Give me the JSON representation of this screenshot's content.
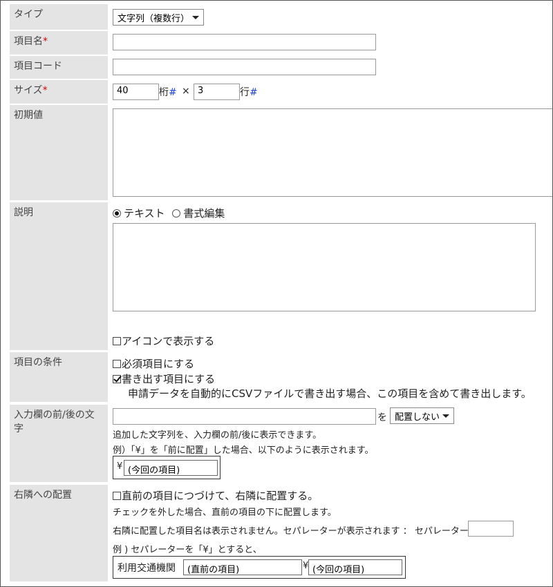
{
  "labels": {
    "type": "タイプ",
    "item_name": "項目名",
    "item_code": "項目コード",
    "size": "サイズ",
    "initial_value": "初期値",
    "description": "説明",
    "condition": "項目の条件",
    "prefix_suffix": "入力欄の前/後の文字",
    "align_right": "右隣への配置",
    "required_mark": "*"
  },
  "type_select": {
    "value": "文字列（複数行）"
  },
  "item_name_input": {
    "value": ""
  },
  "item_code_input": {
    "value": ""
  },
  "size": {
    "cols_value": "40",
    "cols_unit": "桁",
    "hash": "#",
    "times": "×",
    "rows_value": "3",
    "rows_unit": "行"
  },
  "description": {
    "radio_text": "テキスト",
    "radio_rich": "書式編集",
    "selected": "text",
    "show_icon_label": "アイコンで表示する",
    "show_icon_checked": false
  },
  "condition": {
    "required_label": "必須項目にする",
    "required_checked": false,
    "export_label": "書き出す項目にする",
    "export_checked": true,
    "export_note": "申請データを自動的にCSVファイルで書き出す場合、この項目を含めて書き出します。"
  },
  "prefix_suffix": {
    "text_value": "",
    "wo": "を",
    "placement_select": "配置しない",
    "help1": "追加した文字列を、入力欄の前/後に表示できます。",
    "help2": "例）「¥」を「前に配置」した場合、以下のように表示されます。",
    "example_prefix": "¥",
    "example_field": "(今回の項目)"
  },
  "align_right": {
    "checkbox_label": "直前の項目につづけて、右隣に配置する。",
    "checked": false,
    "help1": "チェックを外した場合、直前の項目の下に配置します。",
    "help2": "右隣に配置した項目名は表示されません。セパレーターが表示されます ： セパレーター",
    "separator_value": "",
    "help3": "例 ) セパレーターを「¥」とすると、",
    "example_label": "利用交通機関",
    "example_prev": "(直前の項目)",
    "example_sep": "¥",
    "example_curr": "(今回の項目)"
  }
}
